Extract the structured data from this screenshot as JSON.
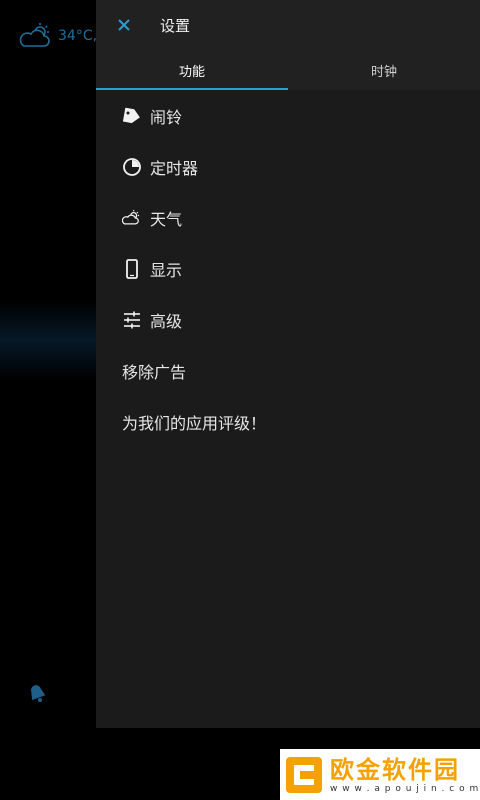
{
  "background": {
    "temperature": "34°C,",
    "accent_color": "#2a9fd6"
  },
  "drawer": {
    "title": "设置",
    "tabs": [
      {
        "label": "功能",
        "active": true
      },
      {
        "label": "时钟",
        "active": false
      }
    ],
    "items": [
      {
        "label": "闹铃",
        "icon": "alarm-tag-icon"
      },
      {
        "label": "定时器",
        "icon": "timer-icon"
      },
      {
        "label": "天气",
        "icon": "weather-icon"
      },
      {
        "label": "显示",
        "icon": "phone-icon"
      },
      {
        "label": "高级",
        "icon": "sliders-icon"
      },
      {
        "label": "移除广告",
        "icon": ""
      },
      {
        "label": "为我们的应用评级！",
        "icon": ""
      }
    ]
  },
  "watermark": {
    "name": "欧金软件园",
    "url": "w w w . a p o u j i n . c o m"
  }
}
